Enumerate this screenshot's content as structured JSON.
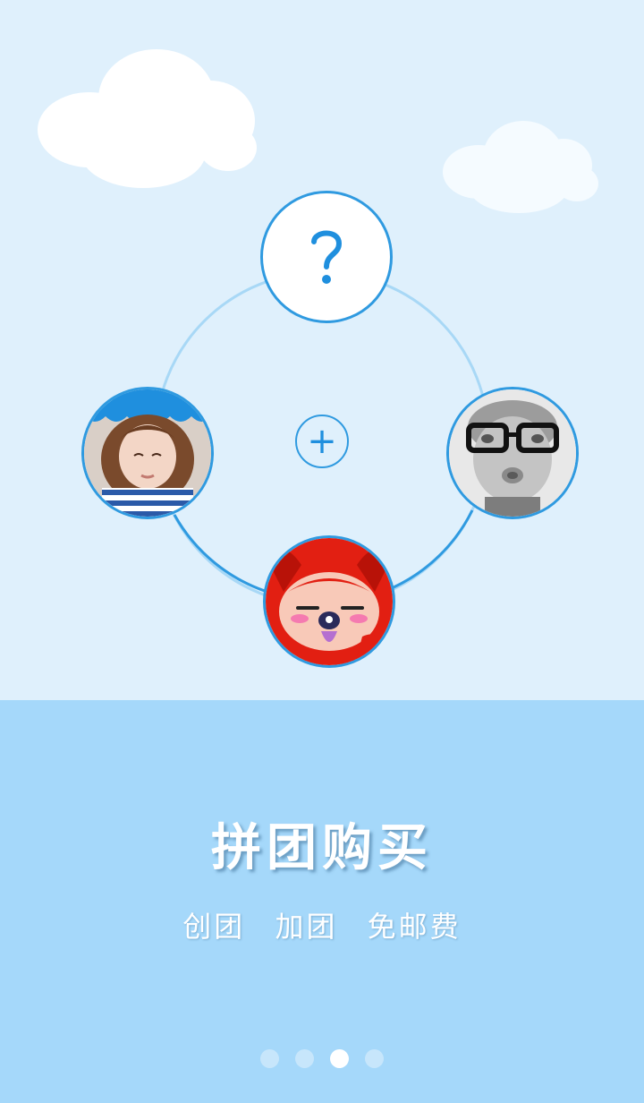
{
  "hero": {
    "question_symbol": "?",
    "plus_symbol": "+"
  },
  "avatars": [
    {
      "name": "avatar-girl",
      "description_icon": "girl-photo"
    },
    {
      "name": "avatar-boy-glasses",
      "description_icon": "boy-photo"
    },
    {
      "name": "avatar-cartoon-fox",
      "description_icon": "cartoon-photo"
    }
  ],
  "onboarding": {
    "title": "拼团购买",
    "subtitle_parts": [
      "创团",
      "加团",
      "免邮费"
    ]
  },
  "pager": {
    "count": 4,
    "active_index": 2
  },
  "colors": {
    "sky": "#dff0fc",
    "panel": "#a5d8fa",
    "accent": "#2f9ae0",
    "dot_inactive": "#c7e6fb",
    "dot_active": "#ffffff"
  }
}
